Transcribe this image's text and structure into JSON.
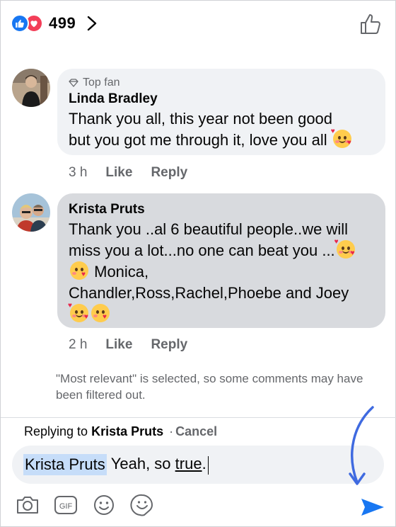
{
  "header": {
    "reactions": [
      {
        "name": "like",
        "color": "#1877f2"
      },
      {
        "name": "love",
        "color": "#f33e58"
      }
    ],
    "reaction_count": "499"
  },
  "comments": [
    {
      "badge": "Top fan",
      "author": "Linda Bradley",
      "lines": [
        "Thank you all, this year not been good",
        "but you got me through it, love you all"
      ],
      "time": "3 h",
      "like_label": "Like",
      "reply_label": "Reply"
    },
    {
      "author": "Krista Pruts",
      "lines": [
        "Thank you ..al 6 beautiful people..we will",
        "miss you a lot...no one can beat you ...",
        " Monica,",
        "Chandler,Ross,Rachel,Phoebe and Joey",
        ""
      ],
      "time": "2 h",
      "like_label": "Like",
      "reply_label": "Reply"
    }
  ],
  "notice": "\"Most relevant\" is selected, so some comments may have been filtered out.",
  "composer": {
    "replying_prefix": "Replying to",
    "replying_name": "Krista Pruts",
    "separator": "·",
    "cancel_label": "Cancel",
    "mention": "Krista Pruts",
    "typed_before": "Yeah, so ",
    "typed_underlined": "true",
    "typed_after": "."
  },
  "toolbar": {
    "icons": [
      "camera-icon",
      "gif-icon",
      "emoji-icon",
      "sticker-icon"
    ],
    "gif_label": "GIF"
  },
  "colors": {
    "accent": "#1877f2",
    "bubble_highlight": "#d8dade",
    "bubble": "#f0f2f5",
    "secondary_text": "#65676b"
  }
}
